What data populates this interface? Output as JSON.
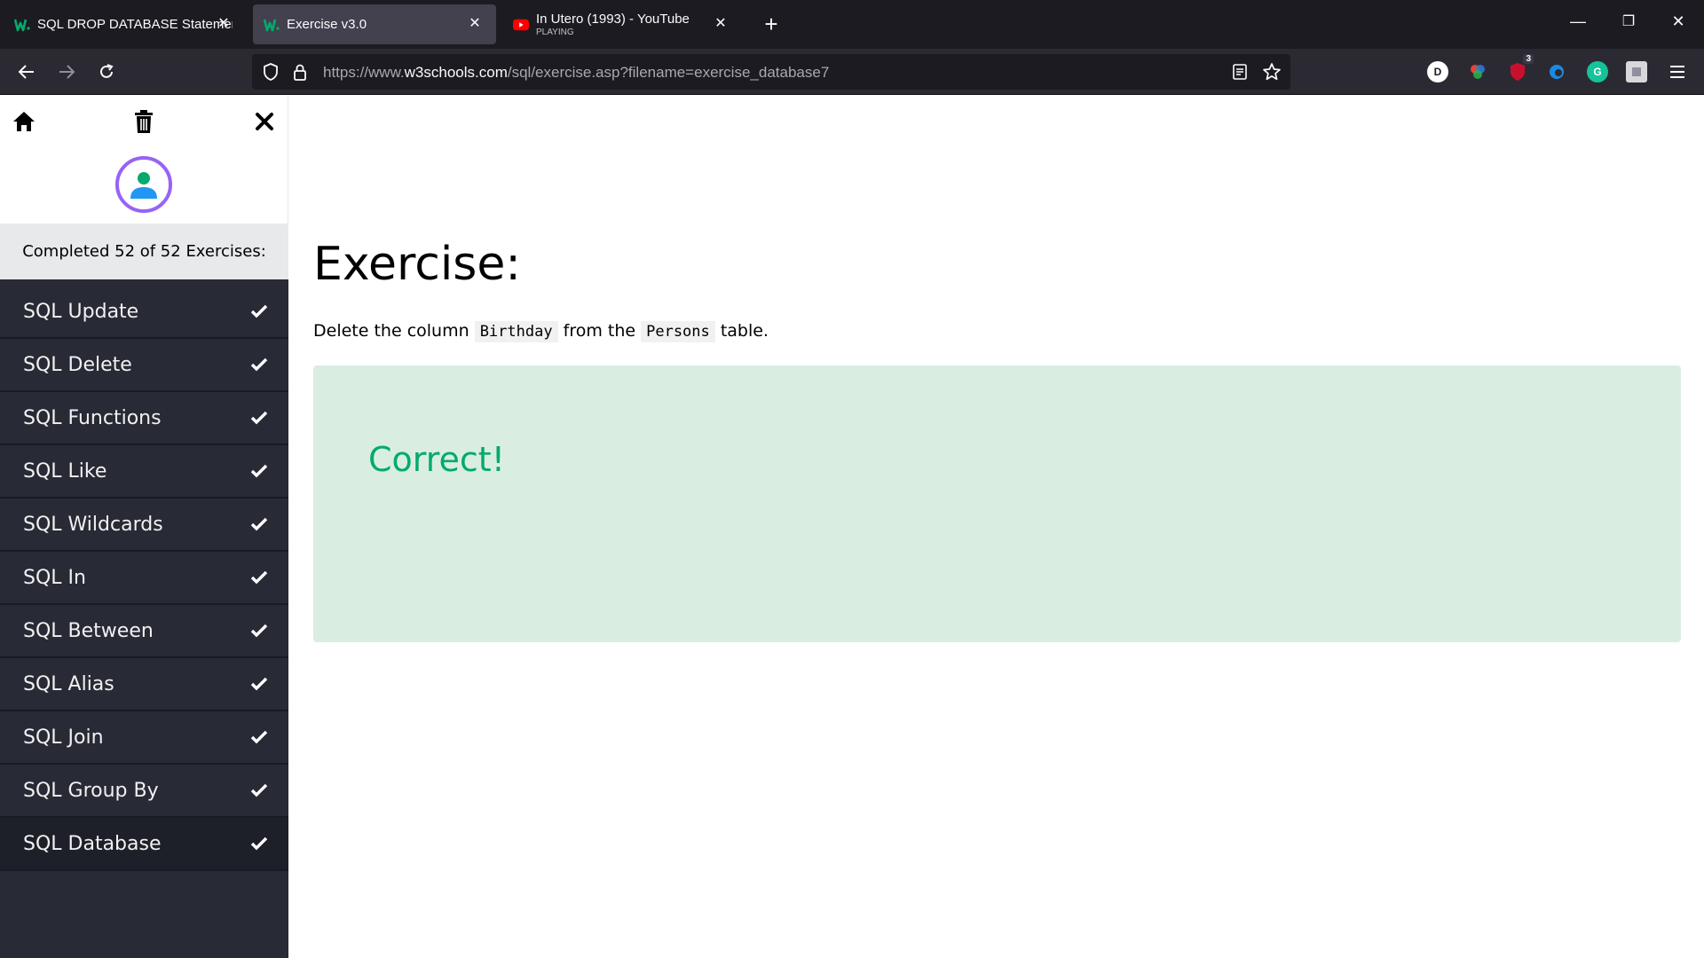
{
  "browser": {
    "tabs": [
      {
        "title": "SQL DROP DATABASE Statemen",
        "favicon": "w3schools-icon",
        "active": false
      },
      {
        "title": "Exercise v3.0",
        "favicon": "w3schools-icon",
        "active": true
      },
      {
        "title": "In Utero (1993) - YouTube",
        "subtitle": "PLAYING",
        "favicon": "youtube-icon",
        "active": false
      }
    ],
    "new_tab_label": "+",
    "url_prefix": "https://www.",
    "url_domain": "w3schools.com",
    "url_path": "/sql/exercise.asp?filename=exercise_database7",
    "extension_badge": "3",
    "extension_letter": "D"
  },
  "sidebar": {
    "progress_label": "Completed 52 of 52 Exercises:",
    "items": [
      {
        "label": "SQL Update"
      },
      {
        "label": "SQL Delete"
      },
      {
        "label": "SQL Functions"
      },
      {
        "label": "SQL Like"
      },
      {
        "label": "SQL Wildcards"
      },
      {
        "label": "SQL In"
      },
      {
        "label": "SQL Between"
      },
      {
        "label": "SQL Alias"
      },
      {
        "label": "SQL Join"
      },
      {
        "label": "SQL Group By"
      },
      {
        "label": "SQL Database"
      }
    ]
  },
  "main": {
    "title": "Exercise:",
    "instruction_pre": "Delete the column",
    "instruction_code1": "Birthday",
    "instruction_mid": "from the",
    "instruction_code2": "Persons",
    "instruction_post": "table.",
    "result": "Correct!"
  },
  "colors": {
    "chrome_bg": "#1c1b22",
    "sidebar_bg": "#282a35",
    "success_bg": "#d9eee1",
    "success_text": "#04aa6d",
    "avatar_ring": "#9763f6"
  }
}
